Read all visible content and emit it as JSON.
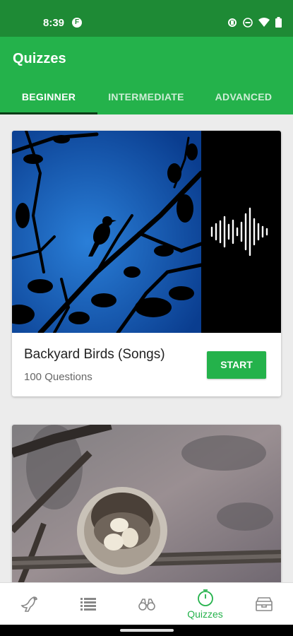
{
  "status_bar": {
    "time": "8:39",
    "notification_icon": "F",
    "icons": [
      "vibrate-icon",
      "dnd-icon",
      "wifi-icon",
      "battery-icon"
    ]
  },
  "app_bar": {
    "title": "Quizzes"
  },
  "tabs": [
    {
      "label": "BEGINNER",
      "active": true
    },
    {
      "label": "INTERMEDIATE",
      "active": false
    },
    {
      "label": "ADVANCED",
      "active": false
    }
  ],
  "quizzes": [
    {
      "title": "Backyard Birds (Songs)",
      "subtitle": "100 Questions",
      "button": "START",
      "image": "bird-silhouette-song"
    },
    {
      "image": "hummingbird-nest-eggs"
    }
  ],
  "bottom_nav": [
    {
      "icon": "bird-icon",
      "label": "",
      "active": false
    },
    {
      "icon": "list-icon",
      "label": "",
      "active": false
    },
    {
      "icon": "binoculars-icon",
      "label": "",
      "active": false
    },
    {
      "icon": "stopwatch-icon",
      "label": "Quizzes",
      "active": true
    },
    {
      "icon": "archive-box-icon",
      "label": "",
      "active": false
    }
  ],
  "colors": {
    "status_bar": "#1e8a35",
    "primary": "#24b24b",
    "tab_indicator": "#0b3d17"
  }
}
